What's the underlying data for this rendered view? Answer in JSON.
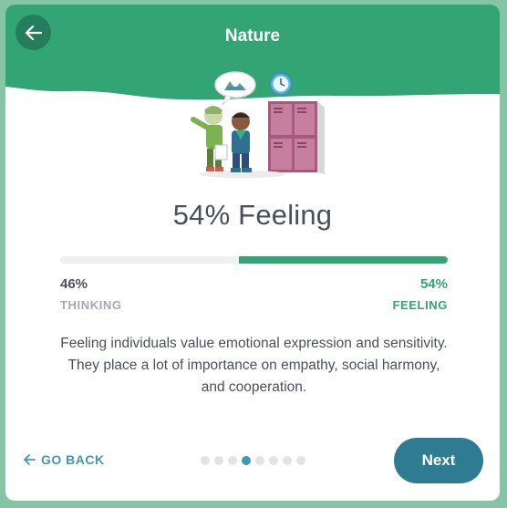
{
  "header": {
    "title": "Nature",
    "back_icon": "arrow-left-icon",
    "color": "#33a474"
  },
  "result": {
    "title": "54% Feeling",
    "left_percent": "46%",
    "left_label": "THINKING",
    "right_percent": "54%",
    "right_label": "FEELING",
    "right_fraction": 0.54,
    "accent_color": "#33a474"
  },
  "description": "Feeling individuals value emotional expression and sensitivity. They place a lot of importance on empathy, social harmony, and cooperation.",
  "footer": {
    "go_back_label": "GO BACK",
    "next_label": "Next",
    "pagination": {
      "total": 8,
      "current": 4
    }
  }
}
